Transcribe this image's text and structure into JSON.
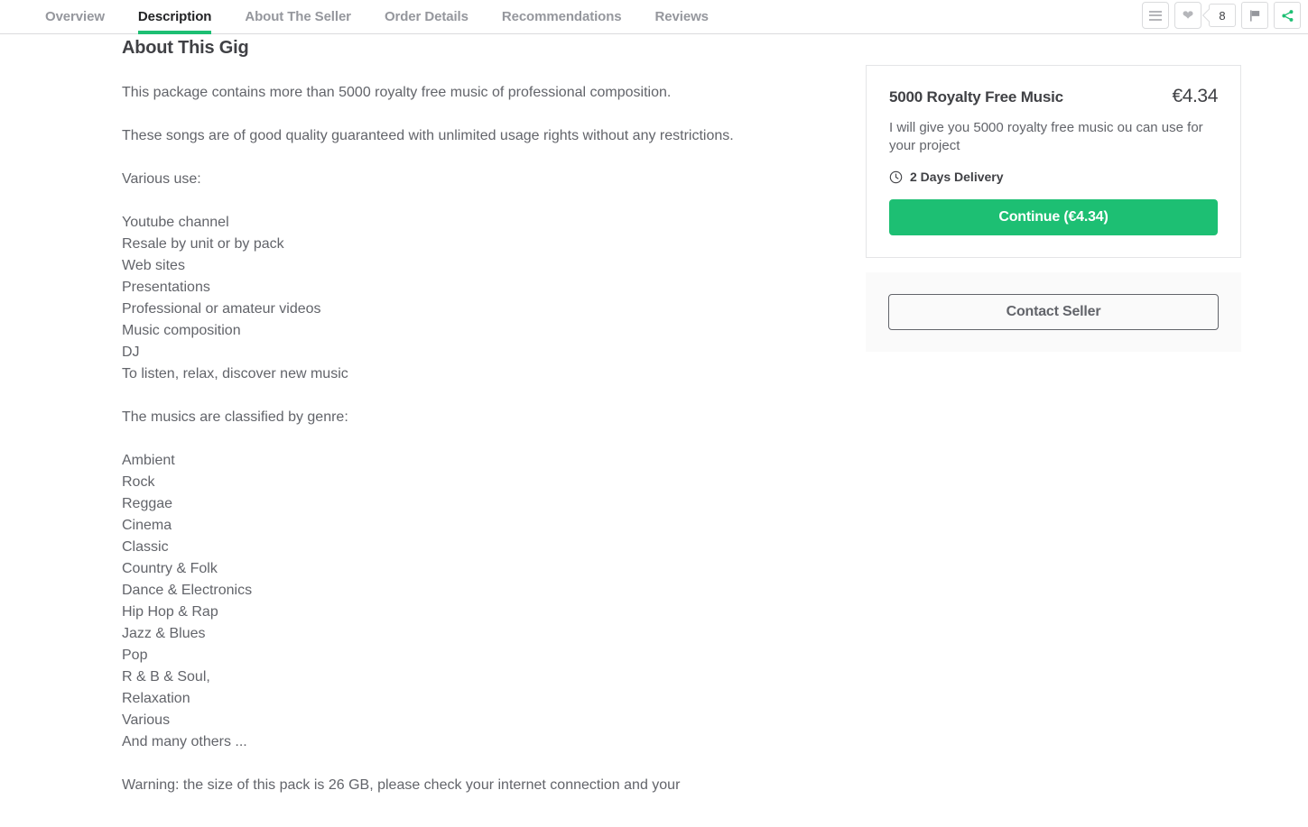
{
  "nav": {
    "tabs": [
      {
        "label": "Overview",
        "active": false
      },
      {
        "label": "Description",
        "active": true
      },
      {
        "label": "About The Seller",
        "active": false
      },
      {
        "label": "Order Details",
        "active": false
      },
      {
        "label": "Recommendations",
        "active": false
      },
      {
        "label": "Reviews",
        "active": false
      }
    ],
    "actions": {
      "list_icon": "list-icon",
      "favorite_icon": "heart-icon",
      "favorite_count": "8",
      "report_icon": "flag-icon",
      "share_icon": "share-icon"
    }
  },
  "main": {
    "heading": "About This Gig",
    "body": "This package contains more than 5000 royalty free music of professional composition.\n\nThese songs are of good quality guaranteed with unlimited usage rights without any restrictions.\n\nVarious use:\n\nYoutube channel\nResale by unit or by pack\nWeb sites\nPresentations\nProfessional or amateur videos\nMusic composition\nDJ\nTo listen, relax, discover new music\n\nThe musics are classified by genre:\n\nAmbient\nRock\nReggae\nCinema\nClassic\nCountry & Folk\nDance & Electronics\nHip Hop & Rap\nJazz & Blues\nPop\nR & B & Soul,\nRelaxation\nVarious\nAnd many others ...\n\nWarning: the size of this pack is 26 GB, please check your internet connection and your"
  },
  "package": {
    "title": "5000 Royalty Free Music",
    "price": "€4.34",
    "description": "I will give you 5000 royalty free music ou can use for your project",
    "delivery": "2 Days Delivery",
    "delivery_icon": "clock-icon",
    "continue_label": "Continue (€4.34)"
  },
  "contact": {
    "button_label": "Contact Seller"
  },
  "colors": {
    "accent_green": "#1dbf73",
    "text_primary": "#404145",
    "text_secondary": "#62646a",
    "text_muted": "#95979d",
    "border": "#dadbdd",
    "panel_bg": "#fafafa"
  }
}
